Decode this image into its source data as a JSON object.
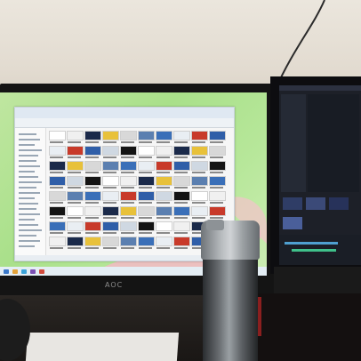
{
  "scene": {
    "description_tag": "",
    "monitor_brand": "AOC"
  },
  "colors": {
    "wallpaper_green": "#b0e38e",
    "explorer_bg": "#f6f6f6",
    "right_screen_bg": "#1d2028",
    "bottle_lid": "#c0c4c7"
  }
}
